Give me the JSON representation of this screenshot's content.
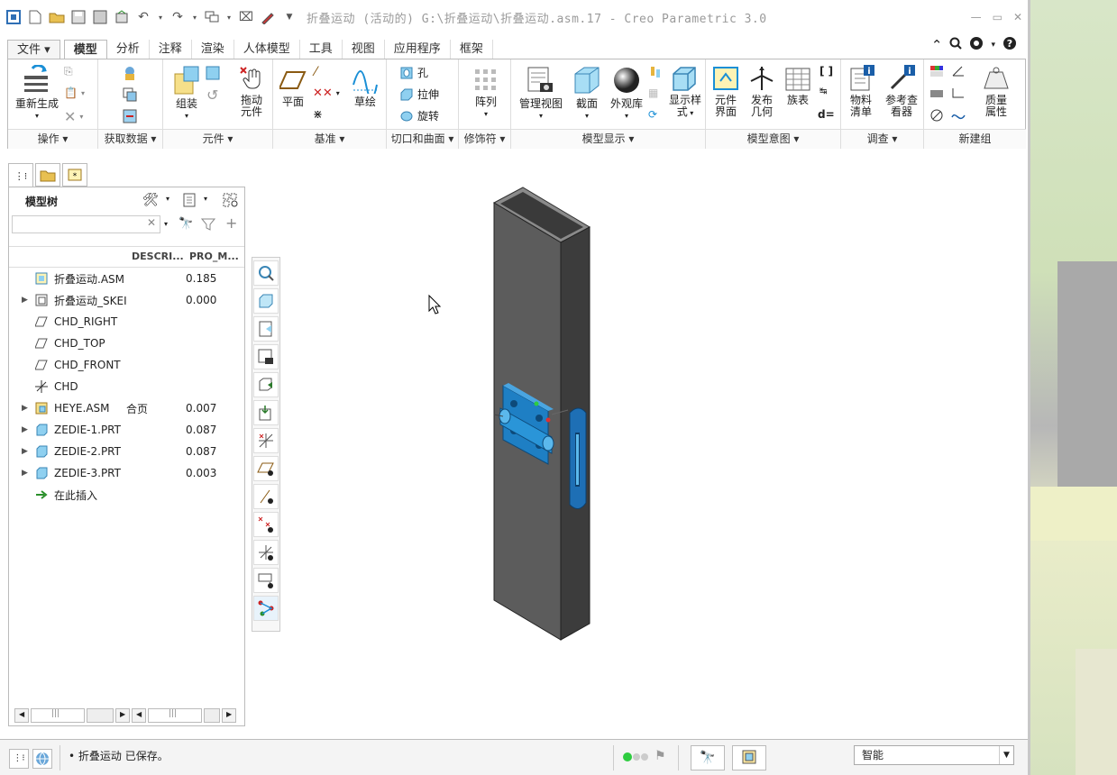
{
  "window": {
    "title": "折叠运动 (活动的) G:\\折叠运动\\折叠运动.asm.17 - Creo Parametric 3.0"
  },
  "menu": {
    "tabs": [
      "文件",
      "模型",
      "分析",
      "注释",
      "渲染",
      "人体模型",
      "工具",
      "视图",
      "应用程序",
      "框架"
    ],
    "active": "模型"
  },
  "ribbon": {
    "groups": {
      "operations": "操作",
      "get_data": "获取数据",
      "components": "元件",
      "datum": "基准",
      "cut_surface": "切口和曲面",
      "modifiers": "修饰符",
      "model_display": "模型显示",
      "model_intent": "模型意图",
      "investigate": "调查",
      "new_group": "新建组"
    },
    "buttons": {
      "regenerate": "重新生成",
      "assemble": "组装",
      "drag_line1": "拖动",
      "drag_line2": "元件",
      "plane": "平面",
      "sketch": "草绘",
      "hole": "孔",
      "extrude": "拉伸",
      "revolve": "旋转",
      "pattern": "阵列",
      "manage_views": "管理视图",
      "section": "截面",
      "appearance": "外观库",
      "display_style_line1": "显示样",
      "display_style_line2": "式",
      "comp_iface_line1": "元件",
      "comp_iface_line2": "界面",
      "publish_line1": "发布",
      "publish_line2": "几何",
      "family_table": "族表",
      "relations": "d=",
      "bom_line1": "物料",
      "bom_line2": "清单",
      "ref_viewer_line1": "参考查",
      "ref_viewer_line2": "看器",
      "mass_line1": "质量",
      "mass_line2": "属性"
    }
  },
  "model_tree": {
    "title": "模型树",
    "columns": [
      "DESCRI...",
      "PRO_M..."
    ],
    "rows": [
      {
        "name": "折叠运动.ASM",
        "desc": "",
        "value": "0.185",
        "expand": false,
        "icon": "assembly-icon"
      },
      {
        "name": "折叠运动_SKEI",
        "desc": "",
        "value": "0.000",
        "expand": true,
        "icon": "skeleton-icon"
      },
      {
        "name": "CHD_RIGHT",
        "desc": "",
        "value": "",
        "expand": false,
        "icon": "datum-plane-icon"
      },
      {
        "name": "CHD_TOP",
        "desc": "",
        "value": "",
        "expand": false,
        "icon": "datum-plane-icon"
      },
      {
        "name": "CHD_FRONT",
        "desc": "",
        "value": "",
        "expand": false,
        "icon": "datum-plane-icon"
      },
      {
        "name": "CHD",
        "desc": "",
        "value": "",
        "expand": false,
        "icon": "csys-icon"
      },
      {
        "name": "HEYE.ASM",
        "desc": "合页",
        "value": "0.007",
        "expand": true,
        "icon": "subassembly-icon"
      },
      {
        "name": "ZEDIE-1.PRT",
        "desc": "",
        "value": "0.087",
        "expand": true,
        "icon": "part-icon"
      },
      {
        "name": "ZEDIE-2.PRT",
        "desc": "",
        "value": "0.087",
        "expand": true,
        "icon": "part-icon"
      },
      {
        "name": "ZEDIE-3.PRT",
        "desc": "",
        "value": "0.003",
        "expand": true,
        "icon": "part-icon"
      },
      {
        "name": "在此插入",
        "desc": "",
        "value": "",
        "expand": false,
        "icon": "insert-here-icon"
      }
    ]
  },
  "status": {
    "message": "折叠运动 已保存。",
    "filter_value": "智能"
  },
  "colors": {
    "accent_blue": "#1a8fd6",
    "hinge_blue": "#1e7fc4",
    "tube_gray": "#555555"
  }
}
